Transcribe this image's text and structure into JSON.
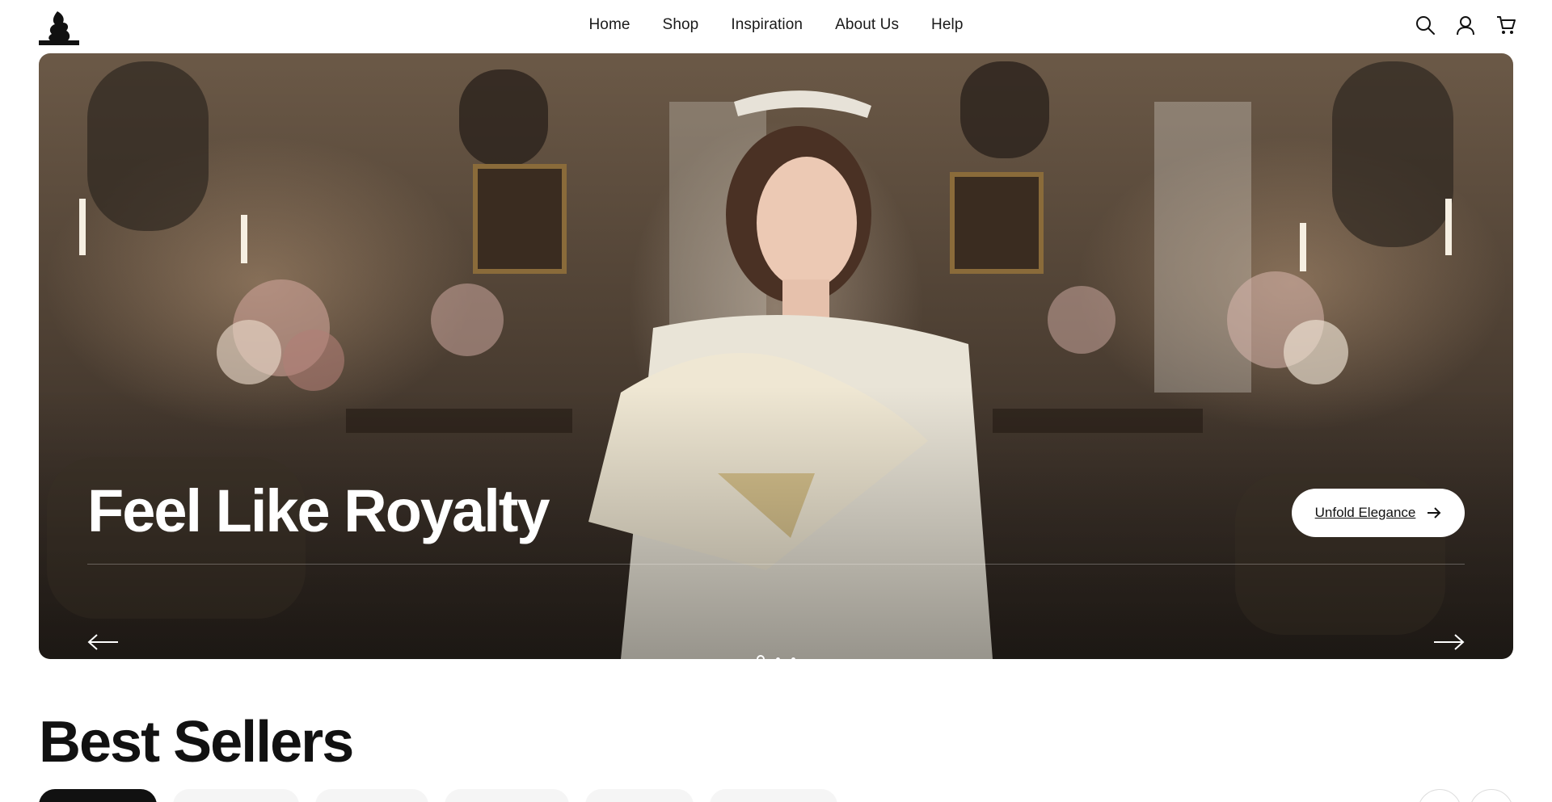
{
  "header": {
    "logo_name": "brand-logo",
    "nav": [
      "Home",
      "Shop",
      "Inspiration",
      "About Us",
      "Help"
    ],
    "icons": [
      "search-icon",
      "account-icon",
      "cart-icon"
    ]
  },
  "hero": {
    "title": "Feel Like Royalty",
    "cta_label": "Unfold Elegance",
    "slides_total": 3,
    "active_slide": 1
  },
  "best_sellers": {
    "title": "Best Sellers"
  },
  "colors": {
    "text": "#111111",
    "hero_button_bg": "#ffffff",
    "active_tab_bg": "#111111"
  }
}
